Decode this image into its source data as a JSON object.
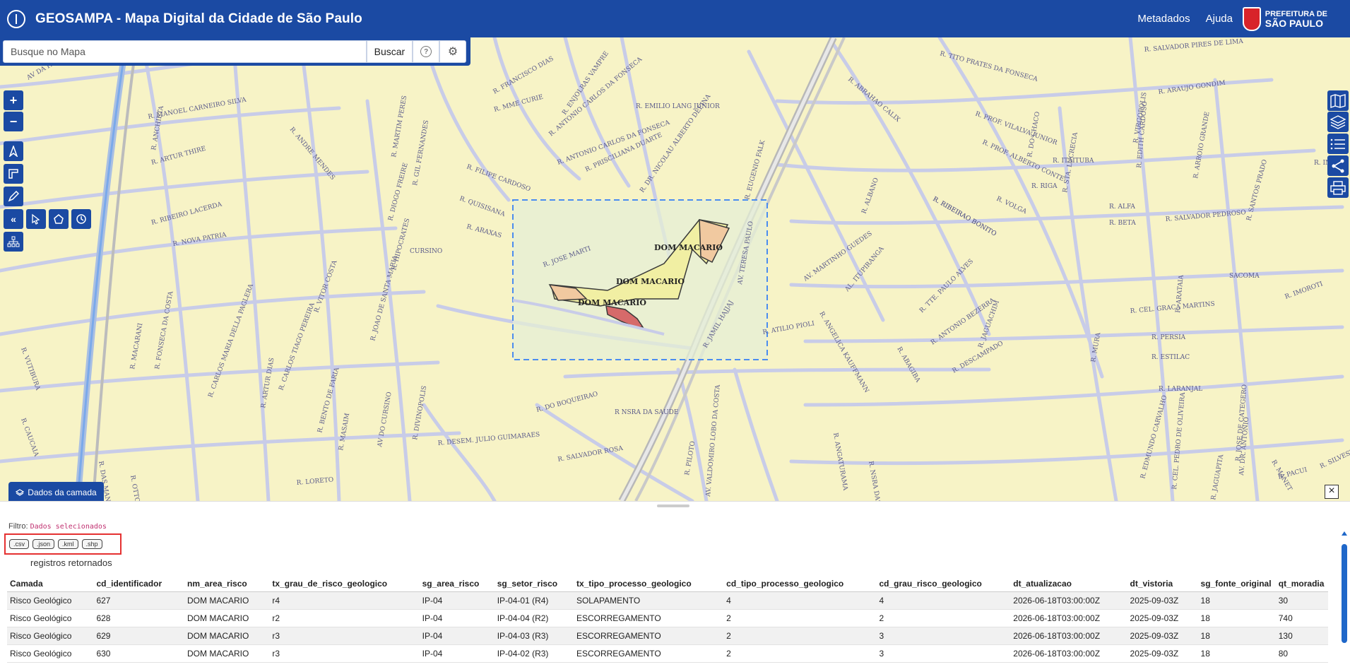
{
  "header": {
    "title": "GEOSAMPA - Mapa Digital da Cidade de São Paulo",
    "nav": [
      "Metadados",
      "Ajuda"
    ],
    "prefeitura_line1": "PREFEITURA DE",
    "prefeitura_line2": "SÃO PAULO"
  },
  "search": {
    "placeholder": "Busque no Mapa",
    "button_label": "Buscar",
    "help_symbol": "?",
    "settings_symbol": "⚙"
  },
  "map": {
    "street_labels": [
      "R. MANOEL CARNEIRO SILVA",
      "R. FRANCISCO DIAS",
      "R. EMILIO LANG JUNIOR",
      "R. ABRAHAO CALIX",
      "R. TITO PRATES DA FONSECA",
      "R. SALVADOR PIRES DE LIMA",
      "R. ARTUR THIRE",
      "R. ANDRE MENDES",
      "R. FILIPE CARDOSO",
      "R. PRISCILIANA DUARTE",
      "R. ANTONIO CARLOS DA FONSECA",
      "R. PROF. VILALVA JUNIOR",
      "R. ARAUJO GONDIM",
      "R. PROF. ALBERTO CONTE",
      "R. ITAITUBA",
      "R. RIGA",
      "R. QUISISANA",
      "R. ARAXAS",
      "R. DR. NICOLAU ALBERTO DEFINA",
      "R. RIBEIRAO BONITO",
      "R. VOLGA",
      "R. ALFA",
      "R. BETA",
      "R. SALVADOR PEDROSO",
      "R. RIBEIRO LACERDA",
      "R. NOVA PATRIA",
      "R. JOSE MARTI",
      "AV. MARTINHO GUEDES",
      "AL. ITUPIRANGA",
      "R. TTE. PAULO ALVES",
      "R. CEL. GRACA MARTINS",
      "R. PERSIA",
      "R. ESTILAC",
      "R. LARANJAL",
      "R. DO BOQUEIRAO",
      "R. ATILIO PIOLI",
      "R. JAMIL HAJJAJ",
      "R. ANTONIO BEZERRA",
      "R. DESCAMPADO",
      "R NSRA DA SAUDE",
      "R. DESEM. JULIO GUIMARAES",
      "R. SALVADOR ROSA",
      "R. LORETO",
      "AV. TERESA PAULO",
      "AV DO CURSINO",
      "R. CARLOS TIAGO PEREIRA",
      "R. CARLOS MARIA DELLA PAGLERA",
      "R. DAS MANGUEIRAS",
      "R. OTTO DE BARROS",
      "R. JOAO DE SANTA MARIA",
      "R. VITOR COSTA",
      "R. HIPOCRATES",
      "R. DIOGO FREIRE",
      "R. GIL FERNANDES",
      "R. MARTIM PERES",
      "R. ENJOLRAS VAMPRE",
      "R. MME CURIE",
      "R. ANTONIO CARLOS DA FONSECA",
      "R. EUGENIO FALK",
      "R. RIBEIRAO BONITO",
      "R. VIRGOPOLIS",
      "R. DO CHACO",
      "R. STA. LUCRECIA",
      "R. EDITH CARDOSO",
      "R. ARROIO GRANDE",
      "R. SANTOS PRADO",
      "R. INDIAS",
      "R. IMOROTI",
      "R. MURA",
      "SACOMA",
      "R. ARATAIA",
      "R. MANET",
      "AV. DR. ANTONIO",
      "R. EDMUNDO CARVALHO",
      "R. CEL. PEDRO DE OLIVEIRA",
      "R. JAGUAPITA",
      "R. JOSE DE CATEGERO",
      "R. PACUI",
      "R. SILVESTRE",
      "R. NSRA DAS MERCES",
      "R. ANGATURAMA",
      "AV. VALDOMIRO LOBO DA COSTA",
      "R. PILOTO",
      "R. ANGELICA KAUFFMANN",
      "R. ALBANO",
      "R. JAGUACHIM",
      "R. ABAGIBA",
      "R. MACARANI",
      "R. FONSECA DA COSTA",
      "R. ARTUR DIAS",
      "R. BENTO DE FARIA",
      "R. MASAIM",
      "R. DIVINOPOLIS",
      "R. VUTIBURA",
      "R. CAUCAIA",
      "R. ANCHIETA",
      "AV DA PAIXAO CERCA",
      "CURSINO"
    ],
    "area_labels": [
      "DOM MACARIO",
      "DOM MACARIO",
      "DOM MACARIO"
    ],
    "colors": {
      "background": "#f7f3c6",
      "street": "#c8cce8",
      "highlight": "#e6efd6",
      "selection_border": "#4a8cf0"
    }
  },
  "left_tools": [
    "plus-icon",
    "minus-icon",
    "north-arrow-icon",
    "measure-icon",
    "pencil-icon",
    "double-chevron-left-icon",
    "select-cursor-icon",
    "polygon-icon",
    "clock-icon",
    "sitemap-icon"
  ],
  "right_tools": [
    "map-book-icon",
    "layers-icon",
    "list-icon",
    "share-icon",
    "print-icon"
  ],
  "dados_tab": {
    "label": "Dados da camada"
  },
  "panel": {
    "close_symbol": "×",
    "filtro_label": "Filtro:",
    "filtro_value": "Dados selecionados",
    "export_buttons": [
      ".csv",
      ".json",
      ".kml",
      ".shp"
    ],
    "registros_label": "registros retornados",
    "table": {
      "headers": [
        "Camada",
        "cd_identificador",
        "nm_area_risco",
        "tx_grau_de_risco_geologico",
        "sg_area_risco",
        "sg_setor_risco",
        "tx_tipo_processo_geologico",
        "cd_tipo_processo_geologico",
        "cd_grau_risco_geologico",
        "dt_atualizacao",
        "dt_vistoria",
        "sg_fonte_original",
        "qt_moradia"
      ],
      "rows": [
        [
          "Risco Geológico",
          "627",
          "DOM MACARIO",
          "r4",
          "IP-04",
          "IP-04-01 (R4)",
          "SOLAPAMENTO",
          "4",
          "4",
          "2026-06-18T03:00:00Z",
          "2025-09-03Z",
          "18",
          "30"
        ],
        [
          "Risco Geológico",
          "628",
          "DOM MACARIO",
          "r2",
          "IP-04",
          "IP-04-04 (R2)",
          "ESCORREGAMENTO",
          "2",
          "2",
          "2026-06-18T03:00:00Z",
          "2025-09-03Z",
          "18",
          "740"
        ],
        [
          "Risco Geológico",
          "629",
          "DOM MACARIO",
          "r3",
          "IP-04",
          "IP-04-03 (R3)",
          "ESCORREGAMENTO",
          "2",
          "3",
          "2026-06-18T03:00:00Z",
          "2025-09-03Z",
          "18",
          "130"
        ],
        [
          "Risco Geológico",
          "630",
          "DOM MACARIO",
          "r3",
          "IP-04",
          "IP-04-02 (R3)",
          "ESCORREGAMENTO",
          "2",
          "3",
          "2026-06-18T03:00:00Z",
          "2025-09-03Z",
          "18",
          "80"
        ]
      ]
    }
  }
}
